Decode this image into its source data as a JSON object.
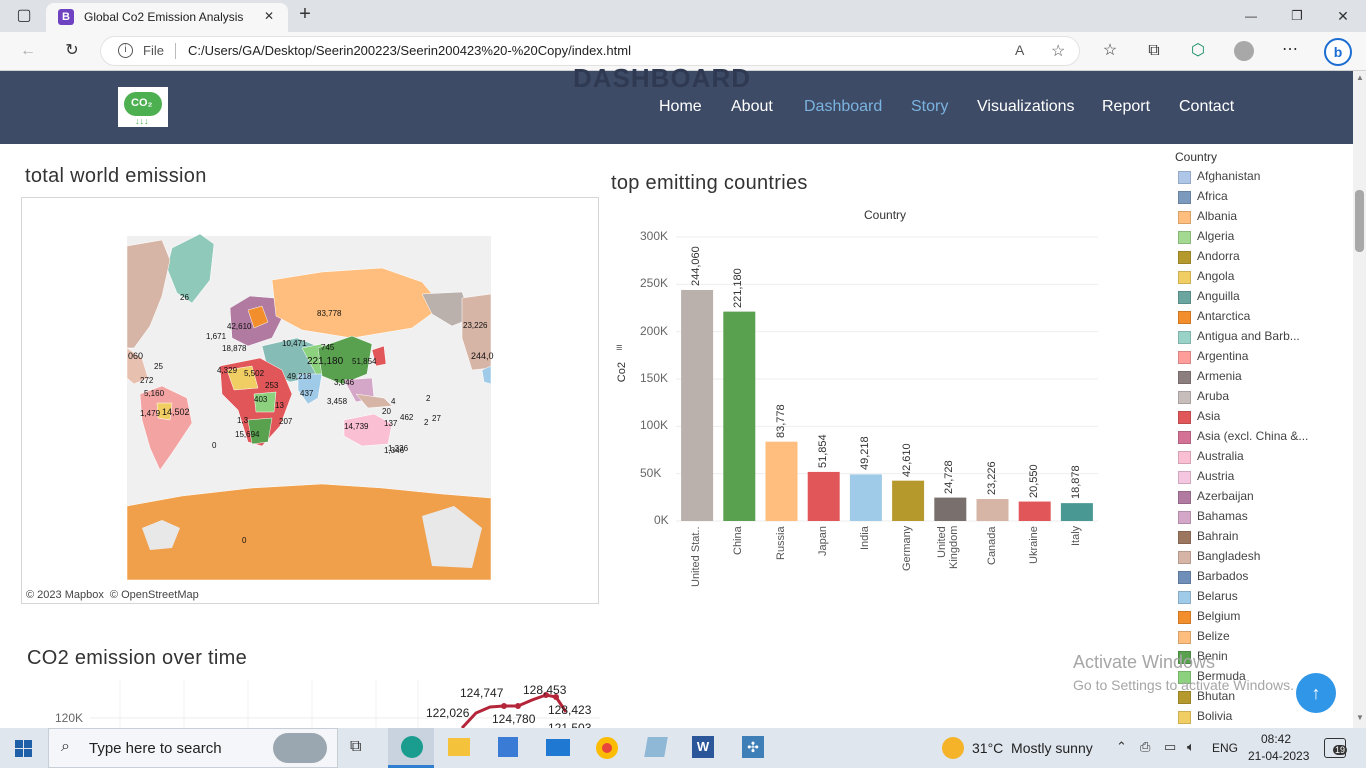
{
  "browser": {
    "tab_title": "Global Co2 Emission Analysis",
    "tab_favicon": "B",
    "file_label": "File",
    "url": "C:/Users/GA/Desktop/Seerin200223/Seerin200423%20-%20Copy/index.html",
    "min_icon": "—",
    "max_icon": "❐",
    "close_icon": "✕",
    "tab_close": "✕",
    "new_tab": "+"
  },
  "site": {
    "logo_text": "CO₂",
    "nav": [
      {
        "label": "Home",
        "color": "#ffffff"
      },
      {
        "label": "About",
        "color": "#ffffff"
      },
      {
        "label": "Dashboard",
        "color": "#7bb3e0"
      },
      {
        "label": "Story",
        "color": "#7bb3e0"
      },
      {
        "label": "Visualizations",
        "color": "#ffffff"
      },
      {
        "label": "Report",
        "color": "#ffffff"
      },
      {
        "label": "Contact",
        "color": "#ffffff"
      }
    ],
    "ghost_title": "DASHBOARD"
  },
  "map": {
    "title": "total world emission",
    "attribution": "© 2023 Mapbox  © OpenStreetMap",
    "labels": [
      "26",
      "83,778",
      "23,226",
      "221,180",
      "10,471",
      "745",
      "51,854",
      "244,0",
      "060",
      "25",
      "272",
      "4,329",
      "5,502",
      "253",
      "1,671",
      "14,502",
      "42,610",
      "1,3",
      "18,878",
      "1,346",
      "437",
      "3,046",
      "49,218",
      "27",
      "14,739",
      "1,336",
      "0",
      "0",
      "13",
      "2",
      "4",
      "20",
      "137",
      "2",
      "207",
      "15,694",
      "403",
      "462",
      "3,458",
      "1,479",
      "5,160"
    ]
  },
  "chart_data": [
    {
      "type": "bar",
      "title": "top emitting countries",
      "subtitle": "Country",
      "ylabel": "Co2",
      "categories": [
        "United Stat..",
        "China",
        "Russia",
        "Japan",
        "India",
        "Germany",
        "United Kingdom",
        "Canada",
        "Ukraine",
        "Italy"
      ],
      "values": [
        244060,
        221180,
        83778,
        51854,
        49218,
        42610,
        24728,
        23226,
        20550,
        18878
      ],
      "value_labels": [
        "244,060",
        "221,180",
        "83,778",
        "51,854",
        "49,218",
        "42,610",
        "24,728",
        "23,226",
        "20,550",
        "18,878"
      ],
      "colors": [
        "#bab0ac",
        "#59a14f",
        "#ffbe7d",
        "#e15759",
        "#a0cbe8",
        "#b6992d",
        "#79706e",
        "#d7b5a6",
        "#e15759",
        "#499894"
      ],
      "yticks": [
        "300K",
        "250K",
        "200K",
        "150K",
        "100K",
        "50K",
        "0K"
      ],
      "ylim": [
        0,
        300000
      ]
    },
    {
      "type": "line",
      "title": "CO2 emission over time",
      "yticks": [
        "120K"
      ],
      "point_labels": [
        "124,747",
        "128,453",
        "122,026",
        "124,780",
        "128,423",
        "121,503"
      ]
    }
  ],
  "legend": {
    "title": "Country",
    "items": [
      {
        "name": "Afghanistan",
        "color": "#aec7e8"
      },
      {
        "name": "Africa",
        "color": "#7b9abd"
      },
      {
        "name": "Albania",
        "color": "#ffbe7d"
      },
      {
        "name": "Algeria",
        "color": "#a3d990"
      },
      {
        "name": "Andorra",
        "color": "#b6992d"
      },
      {
        "name": "Angola",
        "color": "#f1ce63"
      },
      {
        "name": "Anguilla",
        "color": "#6aa59f"
      },
      {
        "name": "Antarctica",
        "color": "#f28e2b"
      },
      {
        "name": "Antigua and Barb...",
        "color": "#99d3c8"
      },
      {
        "name": "Argentina",
        "color": "#ff9d9a"
      },
      {
        "name": "Armenia",
        "color": "#8c7e7e"
      },
      {
        "name": "Aruba",
        "color": "#c7bdbb"
      },
      {
        "name": "Asia",
        "color": "#e15759"
      },
      {
        "name": "Asia (excl. China &...",
        "color": "#d37295"
      },
      {
        "name": "Australia",
        "color": "#fabfd2"
      },
      {
        "name": "Austria",
        "color": "#f4c6e0"
      },
      {
        "name": "Azerbaijan",
        "color": "#b07aa1"
      },
      {
        "name": "Bahamas",
        "color": "#d4a6c8"
      },
      {
        "name": "Bahrain",
        "color": "#9d7660"
      },
      {
        "name": "Bangladesh",
        "color": "#d7b5a6"
      },
      {
        "name": "Barbados",
        "color": "#6f8fb8"
      },
      {
        "name": "Belarus",
        "color": "#a0cbe8"
      },
      {
        "name": "Belgium",
        "color": "#f28e2b"
      },
      {
        "name": "Belize",
        "color": "#ffbe7d"
      },
      {
        "name": "Benin",
        "color": "#59a14f"
      },
      {
        "name": "Bermuda",
        "color": "#8cd17d"
      },
      {
        "name": "Bhutan",
        "color": "#b6992d"
      },
      {
        "name": "Bolivia",
        "color": "#f1ce63"
      }
    ]
  },
  "watermark": {
    "line1": "Activate Windows",
    "line2": "Go to Settings to activate Windows."
  },
  "taskbar": {
    "search_placeholder": "Type here to search",
    "weather": "31°C  Mostly sunny",
    "lang": "ENG",
    "time": "08:42",
    "date": "21-04-2023",
    "notif_count": "19"
  }
}
